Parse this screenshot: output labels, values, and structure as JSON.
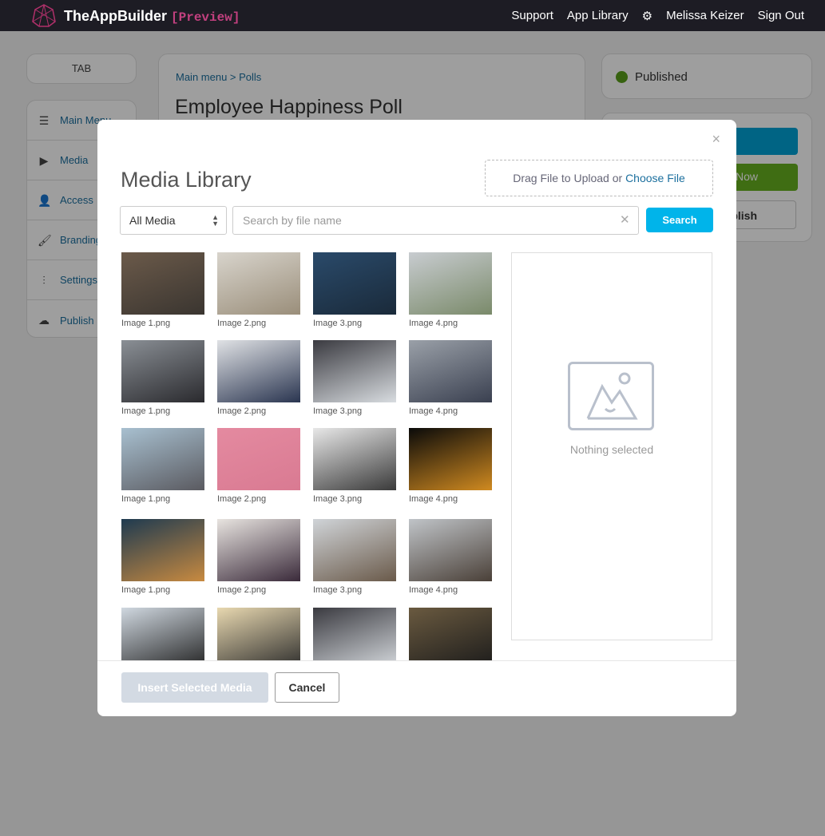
{
  "header": {
    "brand": "TheAppBuilder",
    "brand_tag": "[Preview]",
    "nav": [
      "Support",
      "App Library"
    ],
    "user": "Melissa Keizer",
    "sign_out": "Sign Out"
  },
  "sidebar": {
    "tab": "TAB",
    "items": [
      {
        "label": "Main Menu",
        "icon": "menu-icon"
      },
      {
        "label": "Media",
        "icon": "play-icon"
      },
      {
        "label": "Access",
        "icon": "user-icon"
      },
      {
        "label": "Branding",
        "icon": "brush-icon"
      },
      {
        "label": "Settings",
        "icon": "sliders-icon"
      },
      {
        "label": "Publish",
        "icon": "cloud-upload-icon"
      }
    ]
  },
  "main": {
    "breadcrumb": "Main menu > Polls",
    "title": "Employee Happiness Poll"
  },
  "status": {
    "label": "Published",
    "color": "#5a9e1a"
  },
  "actions": {
    "green_partial": "Now",
    "outline_partial": "blish"
  },
  "modal": {
    "title": "Media Library",
    "close": "×",
    "upload_text": "Drag File to Upload or ",
    "choose_file": "Choose File",
    "filter": "All Media",
    "search_placeholder": "Search by file name",
    "search_value": "",
    "search_button": "Search",
    "nothing_selected": "Nothing selected",
    "insert_button": "Insert Selected Media",
    "cancel_button": "Cancel",
    "images": [
      {
        "label": "Image 1.png",
        "colors": [
          "#6b5a4a",
          "#3a3530"
        ]
      },
      {
        "label": "Image 2.png",
        "colors": [
          "#d8d4cc",
          "#9a8e7a"
        ]
      },
      {
        "label": "Image 3.png",
        "colors": [
          "#2a4a6a",
          "#1a2a3a"
        ]
      },
      {
        "label": "Image 4.png",
        "colors": [
          "#c8ccd0",
          "#7a8a6a"
        ]
      },
      {
        "label": "Image 1.png",
        "colors": [
          "#8a8f95",
          "#2a2a2e"
        ]
      },
      {
        "label": "Image 2.png",
        "colors": [
          "#e0e2e5",
          "#2a3550"
        ]
      },
      {
        "label": "Image 3.png",
        "colors": [
          "#3a3a40",
          "#d8dce0"
        ]
      },
      {
        "label": "Image 4.png",
        "colors": [
          "#9aa0a8",
          "#3a4050"
        ]
      },
      {
        "label": "Image 1.png",
        "colors": [
          "#a8c0d0",
          "#5a5a60"
        ]
      },
      {
        "label": "Image 2.png",
        "colors": [
          "#e48aa0",
          "#d97a92"
        ]
      },
      {
        "label": "Image 3.png",
        "colors": [
          "#e8e8e8",
          "#3a3a3a"
        ]
      },
      {
        "label": "Image 4.png",
        "colors": [
          "#0a0a0a",
          "#d08a20"
        ]
      },
      {
        "label": "Image 1.png",
        "colors": [
          "#1e3a50",
          "#c88a40"
        ]
      },
      {
        "label": "Image 2.png",
        "colors": [
          "#e8e4e0",
          "#3a2a3a"
        ]
      },
      {
        "label": "Image 3.png",
        "colors": [
          "#d0d4d8",
          "#6a5a4a"
        ]
      },
      {
        "label": "Image 4.png",
        "colors": [
          "#c0c4c8",
          "#4a4038"
        ]
      },
      {
        "label": "",
        "colors": [
          "#d0d8e0",
          "#202020"
        ]
      },
      {
        "label": "",
        "colors": [
          "#e8d8b0",
          "#2a2a2a"
        ]
      },
      {
        "label": "",
        "colors": [
          "#3a3a40",
          "#d8dce0"
        ]
      },
      {
        "label": "",
        "colors": [
          "#6a5a40",
          "#1a1a1a"
        ]
      }
    ]
  }
}
